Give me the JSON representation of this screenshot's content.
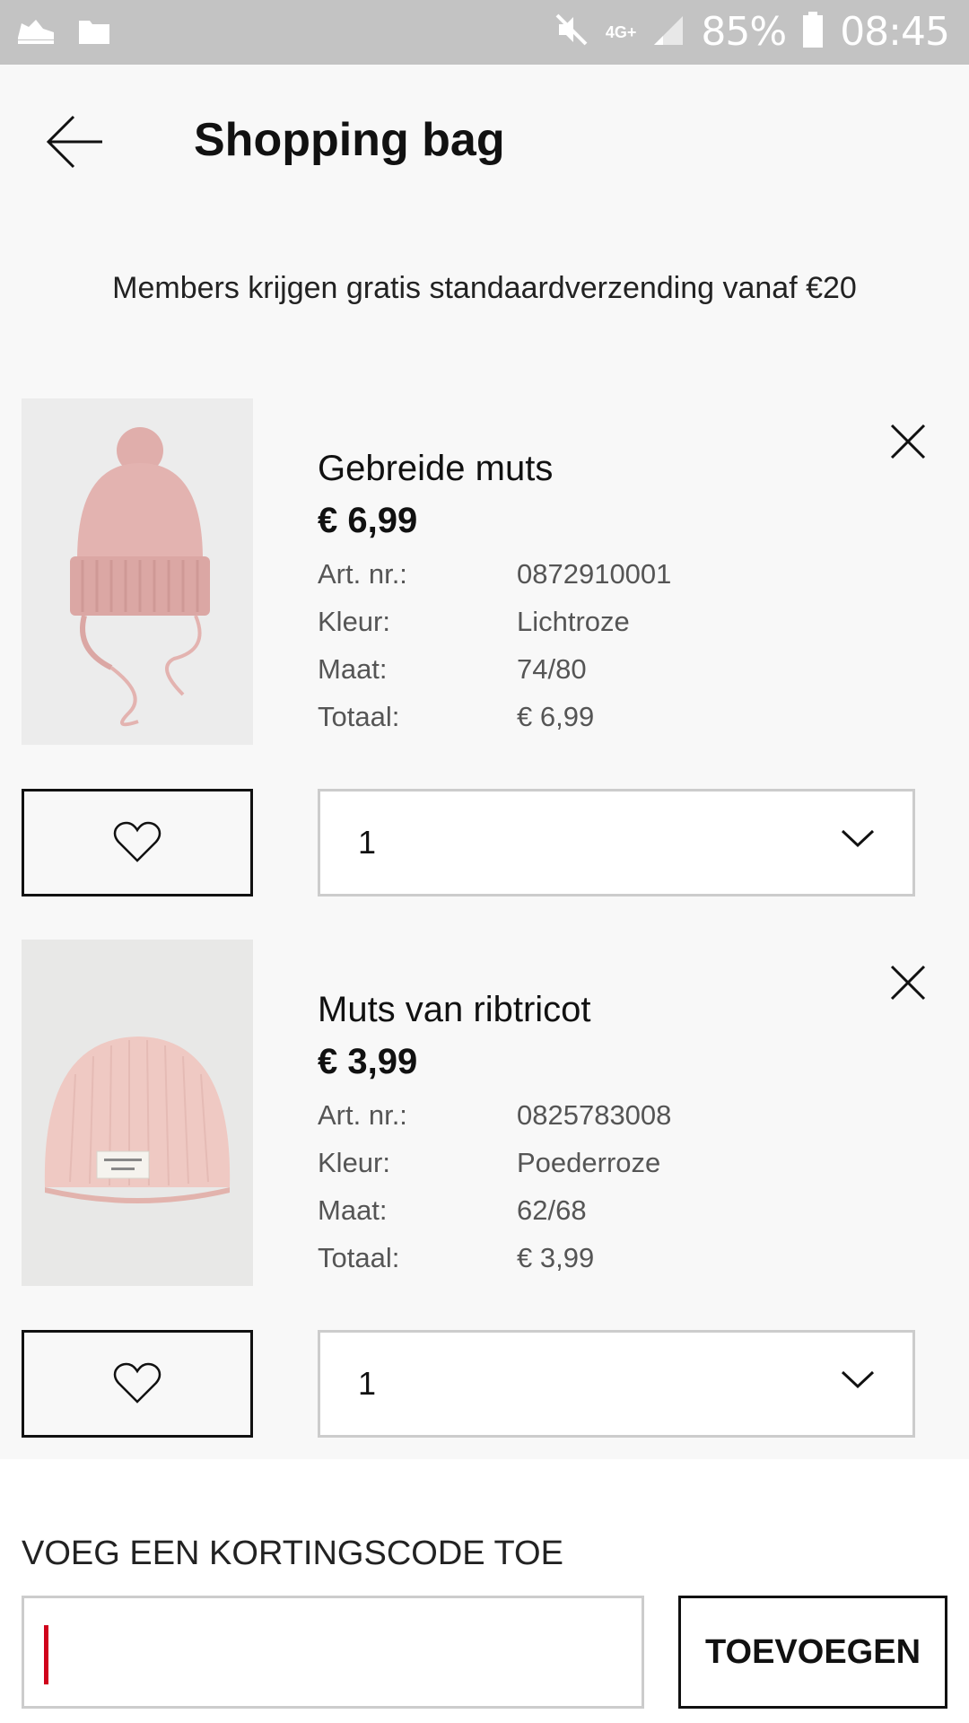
{
  "status_bar": {
    "network": "4G+",
    "battery": "85%",
    "time": "08:45"
  },
  "header": {
    "title": "Shopping bag"
  },
  "promo": "Members krijgen gratis standaardverzending vanaf €20",
  "items": [
    {
      "name": "Gebreide muts",
      "price": "€ 6,99",
      "details": [
        {
          "label": "Art. nr.:",
          "value": "0872910001"
        },
        {
          "label": "Kleur:",
          "value": "Lichtroze"
        },
        {
          "label": "Maat:",
          "value": "74/80"
        },
        {
          "label": "Totaal:",
          "value": "€ 6,99"
        }
      ],
      "quantity": "1"
    },
    {
      "name": "Muts van ribtricot",
      "price": "€ 3,99",
      "details": [
        {
          "label": "Art. nr.:",
          "value": "0825783008"
        },
        {
          "label": "Kleur:",
          "value": "Poederroze"
        },
        {
          "label": "Maat:",
          "value": "62/68"
        },
        {
          "label": "Totaal:",
          "value": "€ 3,99"
        }
      ],
      "quantity": "1"
    }
  ],
  "coupon": {
    "label": "VOEG EEN KORTINGSCODE TOE",
    "value": "",
    "button": "TOEVOEGEN"
  },
  "colors": {
    "status_bar": "#c3c3c3",
    "background": "#f8f8f8",
    "caret": "#d0021b",
    "product_pink": "#e3b3b0"
  }
}
